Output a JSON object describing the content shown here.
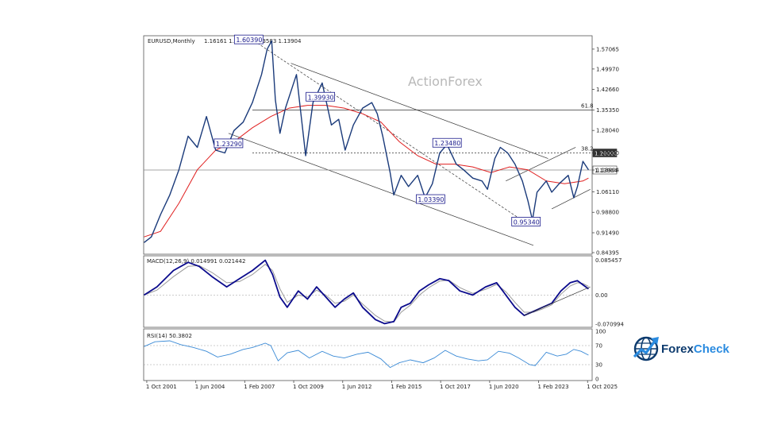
{
  "chart_data": {
    "type": "line",
    "symbol_header": "EURUSD,Monthly",
    "ohlc_header": "1.16161 1.16535 1.13583 1.13904",
    "watermark": "ActionForex",
    "price_axis": {
      "ticks": [
        "1.57065",
        "1.49970",
        "1.42660",
        "1.35350",
        "1.28040",
        "1.20000",
        "1.13904",
        "1.06110",
        "0.98800",
        "0.91490",
        "0.84395"
      ],
      "ylim": [
        0.84395,
        1.61
      ]
    },
    "x_ticks": [
      "1 Oct 2001",
      "1 Jun 2004",
      "1 Feb 2007",
      "1 Oct 2009",
      "1 Jun 2012",
      "1 Feb 2015",
      "1 Oct 2017",
      "1 Jun 2020",
      "1 Feb 2023",
      "1 Oct 2025"
    ],
    "x_tick_years": [
      2001.75,
      2004.42,
      2007.08,
      2009.75,
      2012.42,
      2015.08,
      2017.75,
      2020.42,
      2023.08,
      2025.75
    ],
    "xlim": [
      2001.58,
      2026.0
    ],
    "price_series": {
      "color": "#1a3a7a",
      "x": [
        2001.6,
        2002.0,
        2002.5,
        2003.0,
        2003.5,
        2004.0,
        2004.5,
        2005.0,
        2005.5,
        2006.0,
        2006.5,
        2007.0,
        2007.5,
        2008.0,
        2008.3,
        2008.55,
        2008.75,
        2009.0,
        2009.3,
        2009.9,
        2010.4,
        2010.8,
        2011.3,
        2011.8,
        2012.2,
        2012.55,
        2013.0,
        2013.5,
        2014.0,
        2014.3,
        2014.6,
        2015.0,
        2015.2,
        2015.6,
        2016.0,
        2016.5,
        2016.9,
        2017.3,
        2017.7,
        2018.1,
        2018.6,
        2019.0,
        2019.5,
        2020.0,
        2020.3,
        2020.7,
        2021.0,
        2021.4,
        2021.8,
        2022.2,
        2022.5,
        2022.75,
        2023.0,
        2023.5,
        2023.8,
        2024.2,
        2024.7,
        2025.0,
        2025.2,
        2025.5,
        2025.8
      ],
      "values": [
        0.88,
        0.9,
        0.98,
        1.05,
        1.14,
        1.26,
        1.22,
        1.33,
        1.21,
        1.2,
        1.28,
        1.31,
        1.38,
        1.48,
        1.57,
        1.6,
        1.39,
        1.27,
        1.36,
        1.48,
        1.19,
        1.38,
        1.45,
        1.3,
        1.32,
        1.21,
        1.3,
        1.36,
        1.38,
        1.34,
        1.26,
        1.13,
        1.05,
        1.12,
        1.08,
        1.12,
        1.04,
        1.09,
        1.2,
        1.23,
        1.16,
        1.14,
        1.11,
        1.1,
        1.07,
        1.18,
        1.22,
        1.2,
        1.16,
        1.1,
        1.03,
        0.96,
        1.06,
        1.1,
        1.06,
        1.09,
        1.12,
        1.04,
        1.08,
        1.17,
        1.14
      ]
    },
    "ma_series": {
      "color": "#e02020",
      "x": [
        2001.6,
        2002.5,
        2003.5,
        2004.5,
        2005.5,
        2006.5,
        2007.5,
        2008.5,
        2009.5,
        2010.5,
        2011.5,
        2012.5,
        2013.5,
        2014.5,
        2015.5,
        2016.5,
        2017.5,
        2018.5,
        2019.5,
        2020.5,
        2021.5,
        2022.5,
        2023.5,
        2024.5,
        2025.5,
        2025.8
      ],
      "values": [
        0.9,
        0.92,
        1.02,
        1.14,
        1.21,
        1.24,
        1.29,
        1.33,
        1.36,
        1.37,
        1.37,
        1.36,
        1.34,
        1.31,
        1.24,
        1.19,
        1.16,
        1.16,
        1.15,
        1.13,
        1.15,
        1.14,
        1.1,
        1.09,
        1.1,
        1.11
      ]
    },
    "boxed_prices": [
      {
        "label": "1.60390",
        "x": 2007.3,
        "y": 1.6039
      },
      {
        "label": "1.39930",
        "x": 2011.2,
        "y": 1.3993
      },
      {
        "label": "1.23290",
        "x": 2006.2,
        "y": 1.2329
      },
      {
        "label": "1.23480",
        "x": 2018.1,
        "y": 1.2348
      },
      {
        "label": "1.03390",
        "x": 2017.2,
        "y": 1.0339
      },
      {
        "label": "0.95340",
        "x": 2022.4,
        "y": 0.9534
      }
    ],
    "hlines": [
      {
        "label": "61.8",
        "y": 1.3535,
        "style": "solid"
      },
      {
        "label": "38.2",
        "y": 1.2,
        "style": "dotted"
      },
      {
        "label": "",
        "y": 1.13904,
        "style": "solid-light"
      }
    ],
    "hline_tags": [
      {
        "label": "1.20000",
        "y": 1.2,
        "dark": true
      },
      {
        "label": "1.13904",
        "y": 1.13904,
        "dark": false
      }
    ],
    "macd": {
      "header": "MACD(12,26,9) 0.014991 0.021442",
      "ticks": [
        "0.085457",
        "0.00",
        "-0.070994"
      ],
      "ylim": [
        -0.075,
        0.09
      ],
      "main_color": "#0a0a8c",
      "signal_color": "#9a9a9a",
      "x": [
        2001.6,
        2002.3,
        2003.2,
        2004.0,
        2004.6,
        2005.3,
        2006.1,
        2006.8,
        2007.5,
        2008.2,
        2008.6,
        2009.0,
        2009.4,
        2010.0,
        2010.5,
        2011.0,
        2011.5,
        2012.0,
        2012.5,
        2013.0,
        2013.5,
        2014.2,
        2014.7,
        2015.2,
        2015.6,
        2016.1,
        2016.6,
        2017.1,
        2017.7,
        2018.2,
        2018.8,
        2019.5,
        2020.2,
        2020.8,
        2021.3,
        2021.8,
        2022.3,
        2022.8,
        2023.3,
        2023.8,
        2024.3,
        2024.8,
        2025.2,
        2025.5,
        2025.8
      ],
      "main": [
        0.0,
        0.02,
        0.06,
        0.08,
        0.07,
        0.045,
        0.02,
        0.04,
        0.06,
        0.085,
        0.05,
        -0.005,
        -0.03,
        0.01,
        -0.01,
        0.02,
        -0.005,
        -0.03,
        -0.01,
        0.005,
        -0.03,
        -0.06,
        -0.07,
        -0.065,
        -0.03,
        -0.02,
        0.01,
        0.025,
        0.04,
        0.035,
        0.01,
        0.0,
        0.02,
        0.03,
        0.0,
        -0.03,
        -0.05,
        -0.04,
        -0.03,
        -0.02,
        0.01,
        0.03,
        0.035,
        0.025,
        0.015
      ],
      "signal": [
        0.0,
        0.012,
        0.045,
        0.07,
        0.072,
        0.055,
        0.03,
        0.033,
        0.05,
        0.075,
        0.06,
        0.015,
        -0.018,
        0.0,
        -0.005,
        0.012,
        0.0,
        -0.02,
        -0.015,
        0.0,
        -0.022,
        -0.05,
        -0.064,
        -0.066,
        -0.042,
        -0.025,
        0.0,
        0.018,
        0.034,
        0.036,
        0.018,
        0.004,
        0.014,
        0.026,
        0.008,
        -0.018,
        -0.042,
        -0.042,
        -0.034,
        -0.024,
        0.002,
        0.022,
        0.03,
        0.028,
        0.021
      ]
    },
    "rsi": {
      "header": "RSI(14) 50.3802",
      "ticks": [
        "100",
        "70",
        "30",
        "0"
      ],
      "tick_values": [
        100,
        70,
        30,
        0
      ],
      "ylim": [
        0,
        100
      ],
      "color": "#3a8ad6",
      "x": [
        2001.6,
        2002.2,
        2003.0,
        2003.6,
        2004.3,
        2005.0,
        2005.6,
        2006.3,
        2007.0,
        2007.5,
        2008.2,
        2008.5,
        2008.9,
        2009.4,
        2010.0,
        2010.6,
        2011.3,
        2011.9,
        2012.5,
        2013.2,
        2013.8,
        2014.5,
        2015.0,
        2015.5,
        2016.1,
        2016.8,
        2017.4,
        2018.0,
        2018.6,
        2019.2,
        2019.8,
        2020.3,
        2020.9,
        2021.5,
        2022.0,
        2022.6,
        2022.9,
        2023.5,
        2024.1,
        2024.6,
        2025.0,
        2025.4,
        2025.8
      ],
      "values": [
        68,
        78,
        80,
        72,
        66,
        58,
        46,
        52,
        62,
        66,
        75,
        70,
        38,
        55,
        60,
        44,
        58,
        48,
        44,
        52,
        56,
        42,
        24,
        34,
        40,
        34,
        44,
        60,
        48,
        42,
        38,
        40,
        58,
        54,
        44,
        30,
        28,
        56,
        48,
        52,
        62,
        58,
        50
      ]
    },
    "lower_x_ticks": [
      "1 Oct 2001",
      "1 Jun 2004",
      "1 Feb 2007",
      "1 Oct 2009",
      "1 Jun 2012",
      "1 Feb 2015",
      "1 Oct 2017",
      "1 Jun 2020",
      "1 Feb 2023",
      "1 Oct 2025"
    ]
  },
  "brand": {
    "name": "ForexCheck",
    "name_part1": "Forex",
    "name_part2": "Check",
    "colors": {
      "dark": "#0d3b6e",
      "accent": "#2a8be0"
    }
  }
}
